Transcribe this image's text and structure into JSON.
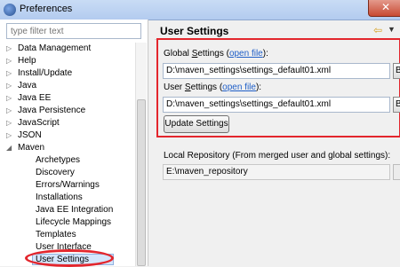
{
  "window": {
    "title": "Preferences",
    "close": "✕"
  },
  "filter": {
    "placeholder": "type filter text"
  },
  "tree": {
    "expand_collapsed": "▷",
    "expand_open": "◢",
    "top_items": [
      "Data Management",
      "Help",
      "Install/Update",
      "Java",
      "Java EE",
      "Java Persistence",
      "JavaScript",
      "JSON"
    ],
    "expanded_item": "Maven",
    "children": [
      "Archetypes",
      "Discovery",
      "Errors/Warnings",
      "Installations",
      "Java EE Integration",
      "Lifecycle Mappings",
      "Templates",
      "User Interface",
      "User Settings"
    ],
    "selected": "User Settings"
  },
  "page": {
    "title": "User Settings",
    "nav_back": "⇦",
    "nav_menu": "▼",
    "global_label": "Global Settings",
    "global_label_pre": "Global ",
    "global_label_mnemonic": "S",
    "global_label_post": "ettings (",
    "open_file": "open file",
    "close_paren": "):",
    "global_path": "D:\\maven_settings\\settings_default01.xml",
    "user_label_pre": "User ",
    "user_label_mnemonic": "S",
    "user_label_post": "ettings (",
    "user_path": "D:\\maven_settings\\settings_default01.xml",
    "browse": "B",
    "update_button": "Update Settings",
    "repo_label": "Local Repository (From merged user and global settings):",
    "repo_path": "E:\\maven_repository"
  },
  "colors": {
    "annotation": "#e3262d",
    "link": "#1e5ec7",
    "selection": "#d4e5fb"
  }
}
